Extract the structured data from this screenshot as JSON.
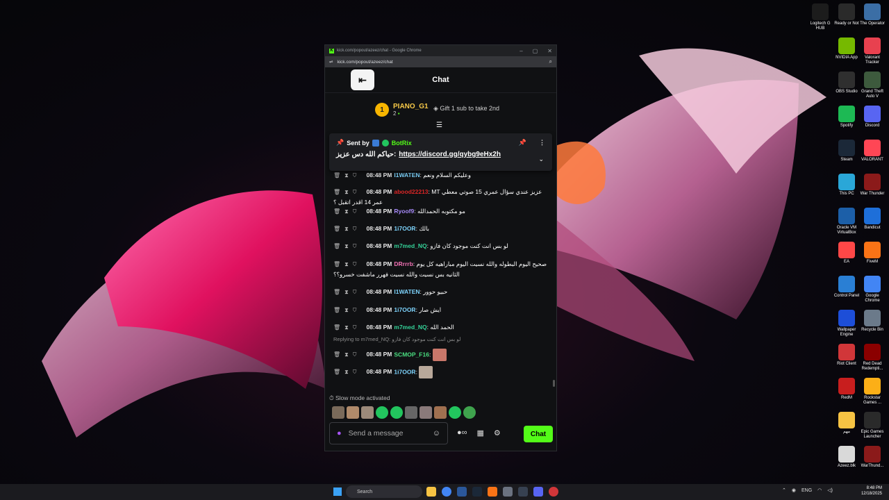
{
  "desktop": {
    "icons": [
      {
        "label": "Logitech G HUB",
        "icon": "logitech-icon",
        "color": "#1c1c1c"
      },
      {
        "label": "Ready or Not",
        "icon": "epic-games-icon",
        "color": "#2a2a2a"
      },
      {
        "label": "The Operator",
        "icon": "operator-icon",
        "color": "#3b6ea5"
      },
      {
        "label": "NVIDIA App",
        "icon": "nvidia-icon",
        "color": "#76b900"
      },
      {
        "label": "Valorant Tracker",
        "icon": "valorant-tracker-icon",
        "color": "#e8414f"
      },
      {
        "label": "OBS Studio",
        "icon": "obs-icon",
        "color": "#2f2f2f"
      },
      {
        "label": "Grand Theft Auto V",
        "icon": "gta-icon",
        "color": "#3d5a3d"
      },
      {
        "label": "Spotify",
        "icon": "spotify-icon",
        "color": "#1db954"
      },
      {
        "label": "Discord",
        "icon": "discord-icon",
        "color": "#5865f2"
      },
      {
        "label": "Steam",
        "icon": "steam-icon",
        "color": "#1b2838"
      },
      {
        "label": "VALORANT",
        "icon": "valorant-icon",
        "color": "#ff4655"
      },
      {
        "label": "This PC",
        "icon": "computer-icon",
        "color": "#2aa7d8"
      },
      {
        "label": "War Thunder",
        "icon": "war-thunder-icon",
        "color": "#8b1a1a"
      },
      {
        "label": "Oracle VM VirtualBox",
        "icon": "virtualbox-icon",
        "color": "#1c5fa8"
      },
      {
        "label": "Bandicut",
        "icon": "bandicut-icon",
        "color": "#1e6fd9"
      },
      {
        "label": "EA",
        "icon": "ea-icon",
        "color": "#ff4747"
      },
      {
        "label": "FiveM",
        "icon": "fivem-icon",
        "color": "#f97316"
      },
      {
        "label": "Control Panel",
        "icon": "control-panel-icon",
        "color": "#2a7fd4"
      },
      {
        "label": "Google Chrome",
        "icon": "chrome-icon",
        "color": "#4285f4"
      },
      {
        "label": "Wallpaper Engine",
        "icon": "wallpaper-engine-icon",
        "color": "#1d4ed8"
      },
      {
        "label": "Recycle Bin",
        "icon": "recycle-bin-icon",
        "color": "#6b7a8a"
      },
      {
        "label": "Riot Client",
        "icon": "riot-icon",
        "color": "#d13639"
      },
      {
        "label": "Red Dead Redempti...",
        "icon": "rdr2-icon",
        "color": "#8b0000"
      },
      {
        "label": "RedM",
        "icon": "redm-icon",
        "color": "#c81e1e"
      },
      {
        "label": "Rockstar Games ...",
        "icon": "rockstar-icon",
        "color": "#fcaf17"
      },
      {
        "label": "مهم",
        "icon": "folder-icon",
        "color": "#f6c343"
      },
      {
        "label": "Epic Games Launcher",
        "icon": "epic-launcher-icon",
        "color": "#2a2a2a"
      },
      {
        "label": "Azeez.blk",
        "icon": "file-icon",
        "color": "#d9d9d9"
      },
      {
        "label": "WarThund...",
        "icon": "war-thunder-icon",
        "color": "#8b1a1a"
      }
    ]
  },
  "window": {
    "title": "kick.com/popout/azeez/chat - Google Chrome",
    "url": "kick.com/popout/azeez/chat"
  },
  "chat": {
    "header_title": "Chat",
    "leaderboard": {
      "rank": "1",
      "name": "PIANO_G1",
      "count": "2",
      "gift_text": "Gift 1 sub to take 2nd"
    },
    "pinned": {
      "sent_by_label": "Sent by",
      "sender": "BotRix",
      "text": "حياكم الله دس عزيز:",
      "link": "https://discord.gg/qybg9eHx2h"
    },
    "messages": [
      {
        "time": "08:48 PM",
        "user": "I1WATEN",
        "color": "#7dd3fc",
        "text": "وعليكم السلام ونعم",
        "partial": true
      },
      {
        "time": "08:48 PM",
        "user": "abood22213",
        "color": "#dc2626",
        "text": "عزيز عندي سؤال عمري 15 صوتي معطي MT عمر 14 اقدر اتقبل ؟"
      },
      {
        "time": "08:48 PM",
        "user": "Ryoof9",
        "color": "#a78bfa",
        "text": "مو مكتوبه الحمدالله"
      },
      {
        "time": "08:48 PM",
        "user": "1i7OOR",
        "color": "#7dd3fc",
        "text": "بالك"
      },
      {
        "time": "08:48 PM",
        "user": "m7med_NQ",
        "color": "#34d399",
        "text": "لو بس انت كنت موجود كان فازو"
      },
      {
        "time": "08:48 PM",
        "user": "DRrrrb",
        "color": "#f472b6",
        "text": "صحيح اليوم البطوله والله نسيت اليوم مباراهيه كل يوم الثانيه بس نسيت والله نسيت فهرر ماشفت خسرو؟؟"
      },
      {
        "time": "08:48 PM",
        "user": "I1WATEN",
        "color": "#7dd3fc",
        "text": "حبيو حوور"
      },
      {
        "time": "08:48 PM",
        "user": "1i7OOR",
        "color": "#7dd3fc",
        "text": "ايش صار"
      },
      {
        "time": "08:48 PM",
        "user": "m7med_NQ",
        "color": "#34d399",
        "text": "الحمد الله"
      },
      {
        "time": "08:48 PM",
        "user": "SCMOP_F16",
        "color": "#4ade80",
        "text": "",
        "reply": "Replying to m7med_NQ: لو بس انت كنت موجود كان فازو"
      },
      {
        "time": "08:48 PM",
        "user": "1i7OOR",
        "color": "#7dd3fc",
        "text": ""
      }
    ],
    "slow_mode": "Slow mode activated",
    "input_placeholder": "Send a message",
    "send_label": "Chat"
  },
  "taskbar": {
    "search_label": "Search",
    "lang": "ENG",
    "time": "8:48 PM",
    "date": "12/18/2025"
  }
}
